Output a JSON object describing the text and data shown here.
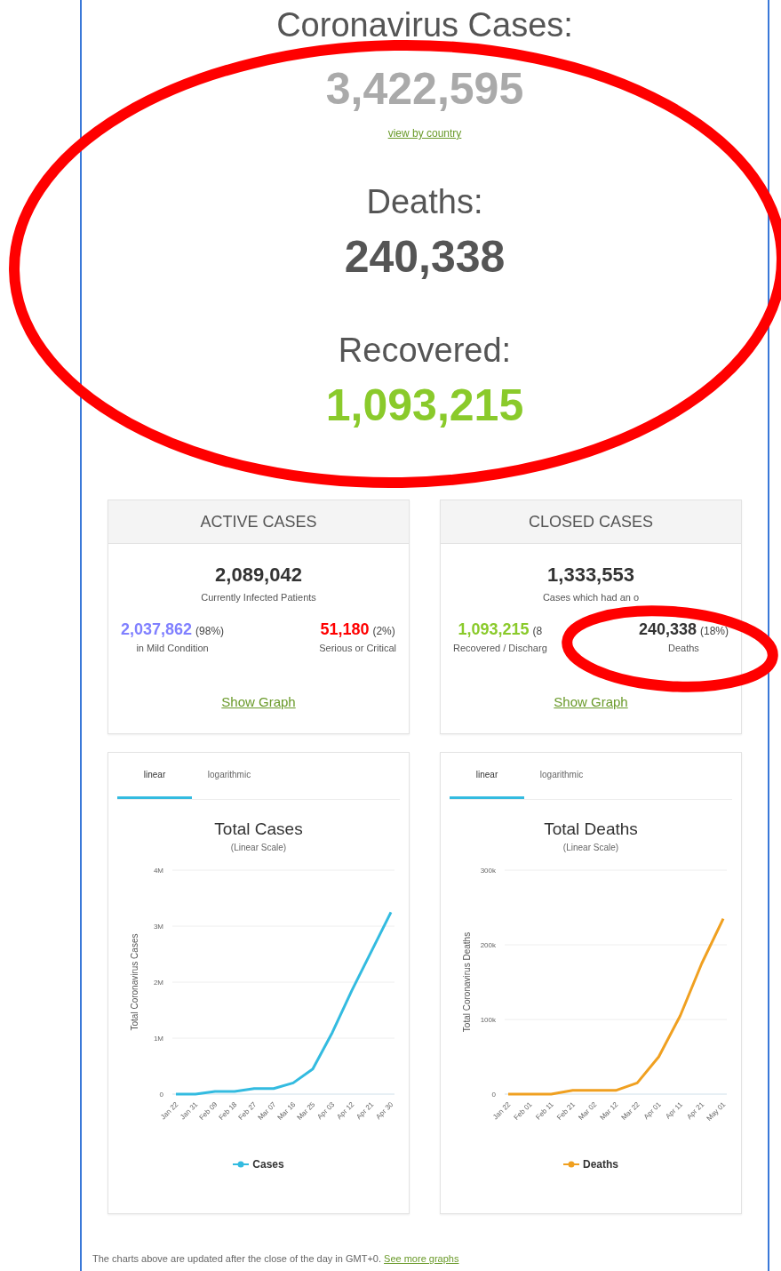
{
  "headline": [
    {
      "label": "Coronavirus Cases:",
      "value": "3,422,595",
      "kind": "cases",
      "link": "view by country"
    },
    {
      "label": "Deaths:",
      "value": "240,338",
      "kind": "deaths"
    },
    {
      "label": "Recovered:",
      "value": "1,093,215",
      "kind": "recovered"
    }
  ],
  "cards": [
    {
      "title": "ACTIVE CASES",
      "total": "2,089,042",
      "caption": "Currently Infected Patients",
      "parts": [
        {
          "value": "2,037,862",
          "pct": "(98%)",
          "label": "in Mild Condition",
          "color": "#8080ff"
        },
        {
          "value": "51,180",
          "pct": "(2%)",
          "label": "Serious or Critical",
          "color": "#ff0000"
        }
      ],
      "link": "Show Graph"
    },
    {
      "title": "CLOSED CASES",
      "total": "1,333,553",
      "caption": "Cases which had an o",
      "parts": [
        {
          "value": "1,093,215",
          "pct": "(8",
          "label": "Recovered / Discharg",
          "color": "#8aca2b"
        },
        {
          "value": "240,338",
          "pct": "(18%)",
          "label": "Deaths",
          "color": "#333333"
        }
      ],
      "link": "Show Graph"
    }
  ],
  "graphs": [
    {
      "tabs": [
        {
          "label": "linear",
          "selected": true
        },
        {
          "label": "logarithmic",
          "selected": false
        }
      ],
      "subtitle": "(Linear Scale)",
      "chart_data": {
        "type": "line",
        "title": "Total Cases",
        "ylabel": "Total Coronavirus Cases",
        "categories": [
          "Jan 22",
          "Jan 31",
          "Feb 09",
          "Feb 18",
          "Feb 27",
          "Mar 07",
          "Mar 16",
          "Mar 25",
          "Apr 03",
          "Apr 12",
          "Apr 21",
          "Apr 30"
        ],
        "series": [
          {
            "name": "Cases",
            "color": "#33bbe0",
            "values": [
              0,
              0,
              50000,
              50000,
              100000,
              100000,
              200000,
              450000,
              1100000,
              1850000,
              2550000,
              3250000
            ]
          }
        ],
        "grid": true,
        "ylim": [
          0,
          4000000
        ],
        "yticks": [
          {
            "value": 0,
            "label": "0"
          },
          {
            "value": 1000000,
            "label": "1M"
          },
          {
            "value": 2000000,
            "label": "2M"
          },
          {
            "value": 3000000,
            "label": "3M"
          },
          {
            "value": 4000000,
            "label": "4M"
          }
        ]
      }
    },
    {
      "tabs": [
        {
          "label": "linear",
          "selected": true
        },
        {
          "label": "logarithmic",
          "selected": false
        }
      ],
      "subtitle": "(Linear Scale)",
      "chart_data": {
        "type": "line",
        "title": "Total Deaths",
        "ylabel": "Total Coronavirus Deaths",
        "categories": [
          "Jan 22",
          "Feb 01",
          "Feb 11",
          "Feb 21",
          "Mar 02",
          "Mar 12",
          "Mar 22",
          "Apr 01",
          "Apr 11",
          "Apr 21",
          "May 01"
        ],
        "series": [
          {
            "name": "Deaths",
            "color": "#f0a020",
            "values": [
              0,
              0,
              0,
              5000,
              5000,
              5000,
              15000,
              50000,
              105000,
              175000,
              235000
            ]
          }
        ],
        "grid": true,
        "ylim": [
          0,
          300000
        ],
        "yticks": [
          {
            "value": 0,
            "label": "0"
          },
          {
            "value": 100000,
            "label": "100k"
          },
          {
            "value": 200000,
            "label": "200k"
          },
          {
            "value": 300000,
            "label": "300k"
          }
        ]
      }
    }
  ],
  "footer": {
    "text": "The charts above are updated after the close of the day in GMT+0.",
    "link": "See more graphs"
  },
  "annotations": [
    {
      "kind": "ellipse"
    },
    {
      "kind": "ellipse"
    }
  ]
}
